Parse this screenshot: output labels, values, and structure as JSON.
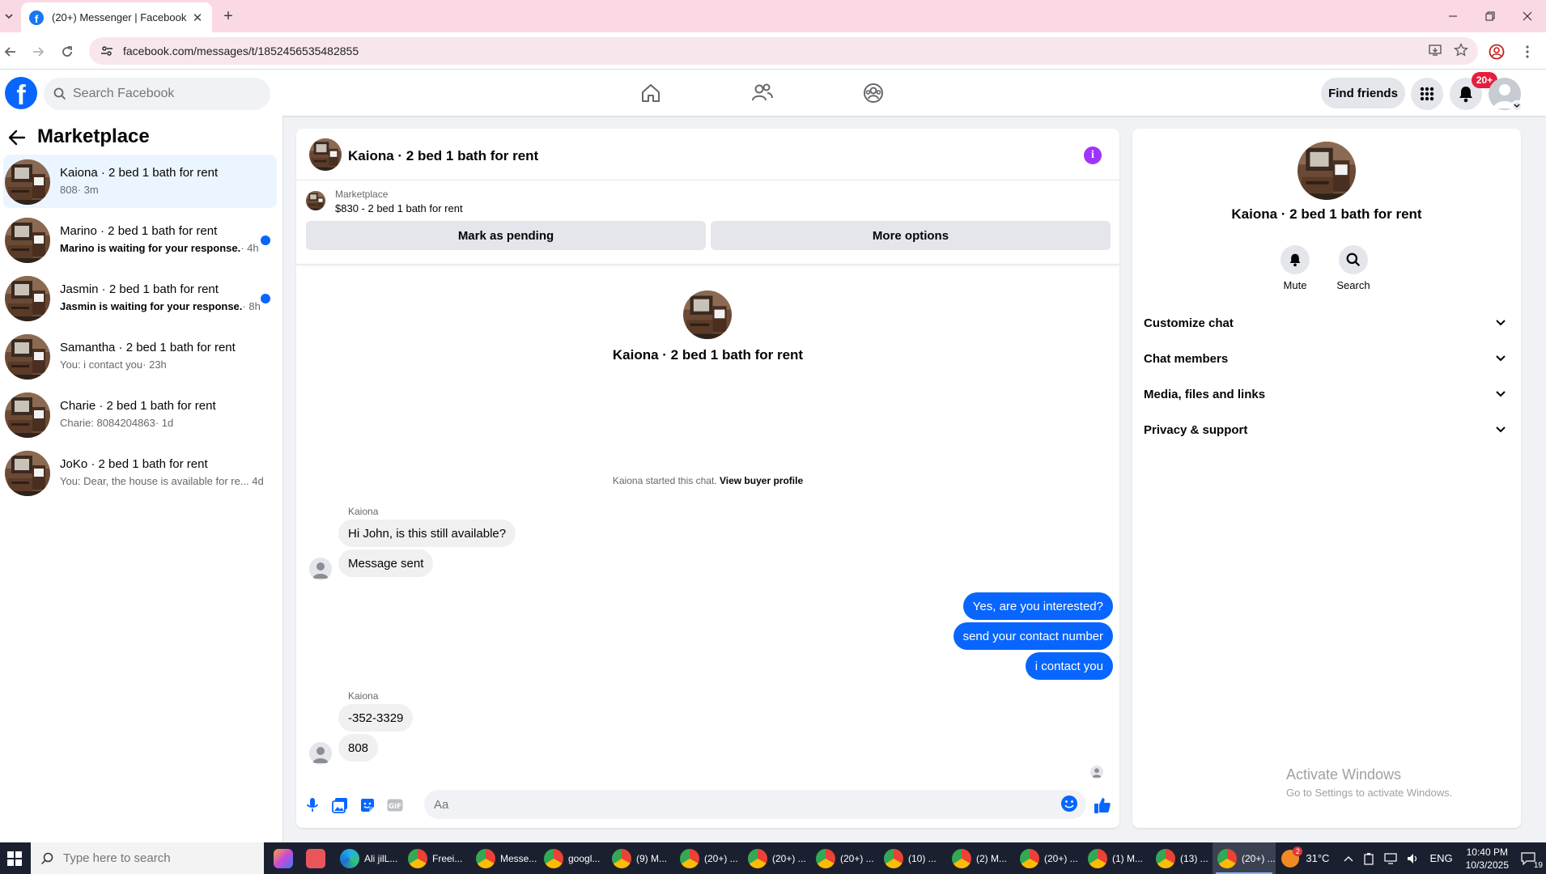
{
  "browser": {
    "tab_title": "(20+) Messenger | Facebook",
    "url": "facebook.com/messages/t/1852456535482855"
  },
  "fb_header": {
    "search_placeholder": "Search Facebook",
    "find_friends_label": "Find friends",
    "notification_count": "20+"
  },
  "marketplace": {
    "title": "Marketplace",
    "conversations": [
      {
        "name": "Kaiona · 2 bed 1 bath for rent",
        "preview": "808",
        "time": "· 3m",
        "unread": false,
        "active": true
      },
      {
        "name": "Marino · 2 bed 1 bath for rent",
        "preview": "Marino is waiting for your response.",
        "time": "· 4h",
        "unread": true,
        "active": false
      },
      {
        "name": "Jasmin · 2 bed 1 bath for rent",
        "preview": "Jasmin is waiting for your response.",
        "time": "· 8h",
        "unread": true,
        "active": false
      },
      {
        "name": "Samantha · 2 bed 1 bath for rent",
        "preview": "You: i contact you",
        "time": "· 23h",
        "unread": false,
        "active": false
      },
      {
        "name": "Charie · 2 bed 1 bath for rent",
        "preview": "Charie: 8084204863",
        "time": "· 1d",
        "unread": false,
        "active": false
      },
      {
        "name": "JoKo · 2 bed 1 bath for rent",
        "preview": "You: Dear, the house is available for re...",
        "time": "4d",
        "unread": false,
        "active": false
      }
    ]
  },
  "chat": {
    "header_name": "Kaiona · 2 bed 1 bath for rent",
    "listing_label": "Marketplace",
    "listing_price": "$830 - 2 bed 1 bath for rent",
    "mark_pending_label": "Mark as pending",
    "more_options_label": "More options",
    "center_name": "Kaiona · 2 bed 1 bath for rent",
    "started_text": "Kaiona started this chat.",
    "view_buyer_label": "View buyer profile",
    "group1_sender": "Kaiona",
    "group1_messages": [
      "Hi John, is this still available?",
      "Message sent"
    ],
    "outgoing_messages": [
      "Yes, are you interested?",
      "send your contact number",
      "i contact you"
    ],
    "group2_sender": "Kaiona",
    "group2_messages": [
      "-352-3329",
      "808"
    ],
    "input_placeholder": "Aa"
  },
  "info_panel": {
    "name": "Kaiona · 2 bed 1 bath for rent",
    "mute_label": "Mute",
    "search_label": "Search",
    "sections": [
      "Customize chat",
      "Chat members",
      "Media, files and links",
      "Privacy & support"
    ],
    "watermark_title": "Activate Windows",
    "watermark_sub": "Go to Settings to activate Windows."
  },
  "taskbar": {
    "search_placeholder": "Type here to search",
    "apps": [
      "Ali jilL...",
      "Freei...",
      "Messe...",
      "googl...",
      "(9) M...",
      "(20+) ...",
      "(20+) ...",
      "(20+) ...",
      "(10) ...",
      "(2) M...",
      "(20+) ...",
      "(1) M...",
      "(13) ...",
      "(20+) ..."
    ],
    "weather": "31°C",
    "language": "ENG",
    "time": "10:40 PM",
    "date": "10/3/2025",
    "notification_count": "19",
    "weather_badge": "2"
  },
  "colors": {
    "brand_blue": "#0866ff",
    "outgoing_bubble": "#0866ff",
    "incoming_bubble": "#f0f0f0",
    "unread_dot": "#0866ff",
    "notif_badge": "#e41e3f",
    "info_icon": "#a033ff",
    "browser_tabbar": "#fbd9e4"
  }
}
